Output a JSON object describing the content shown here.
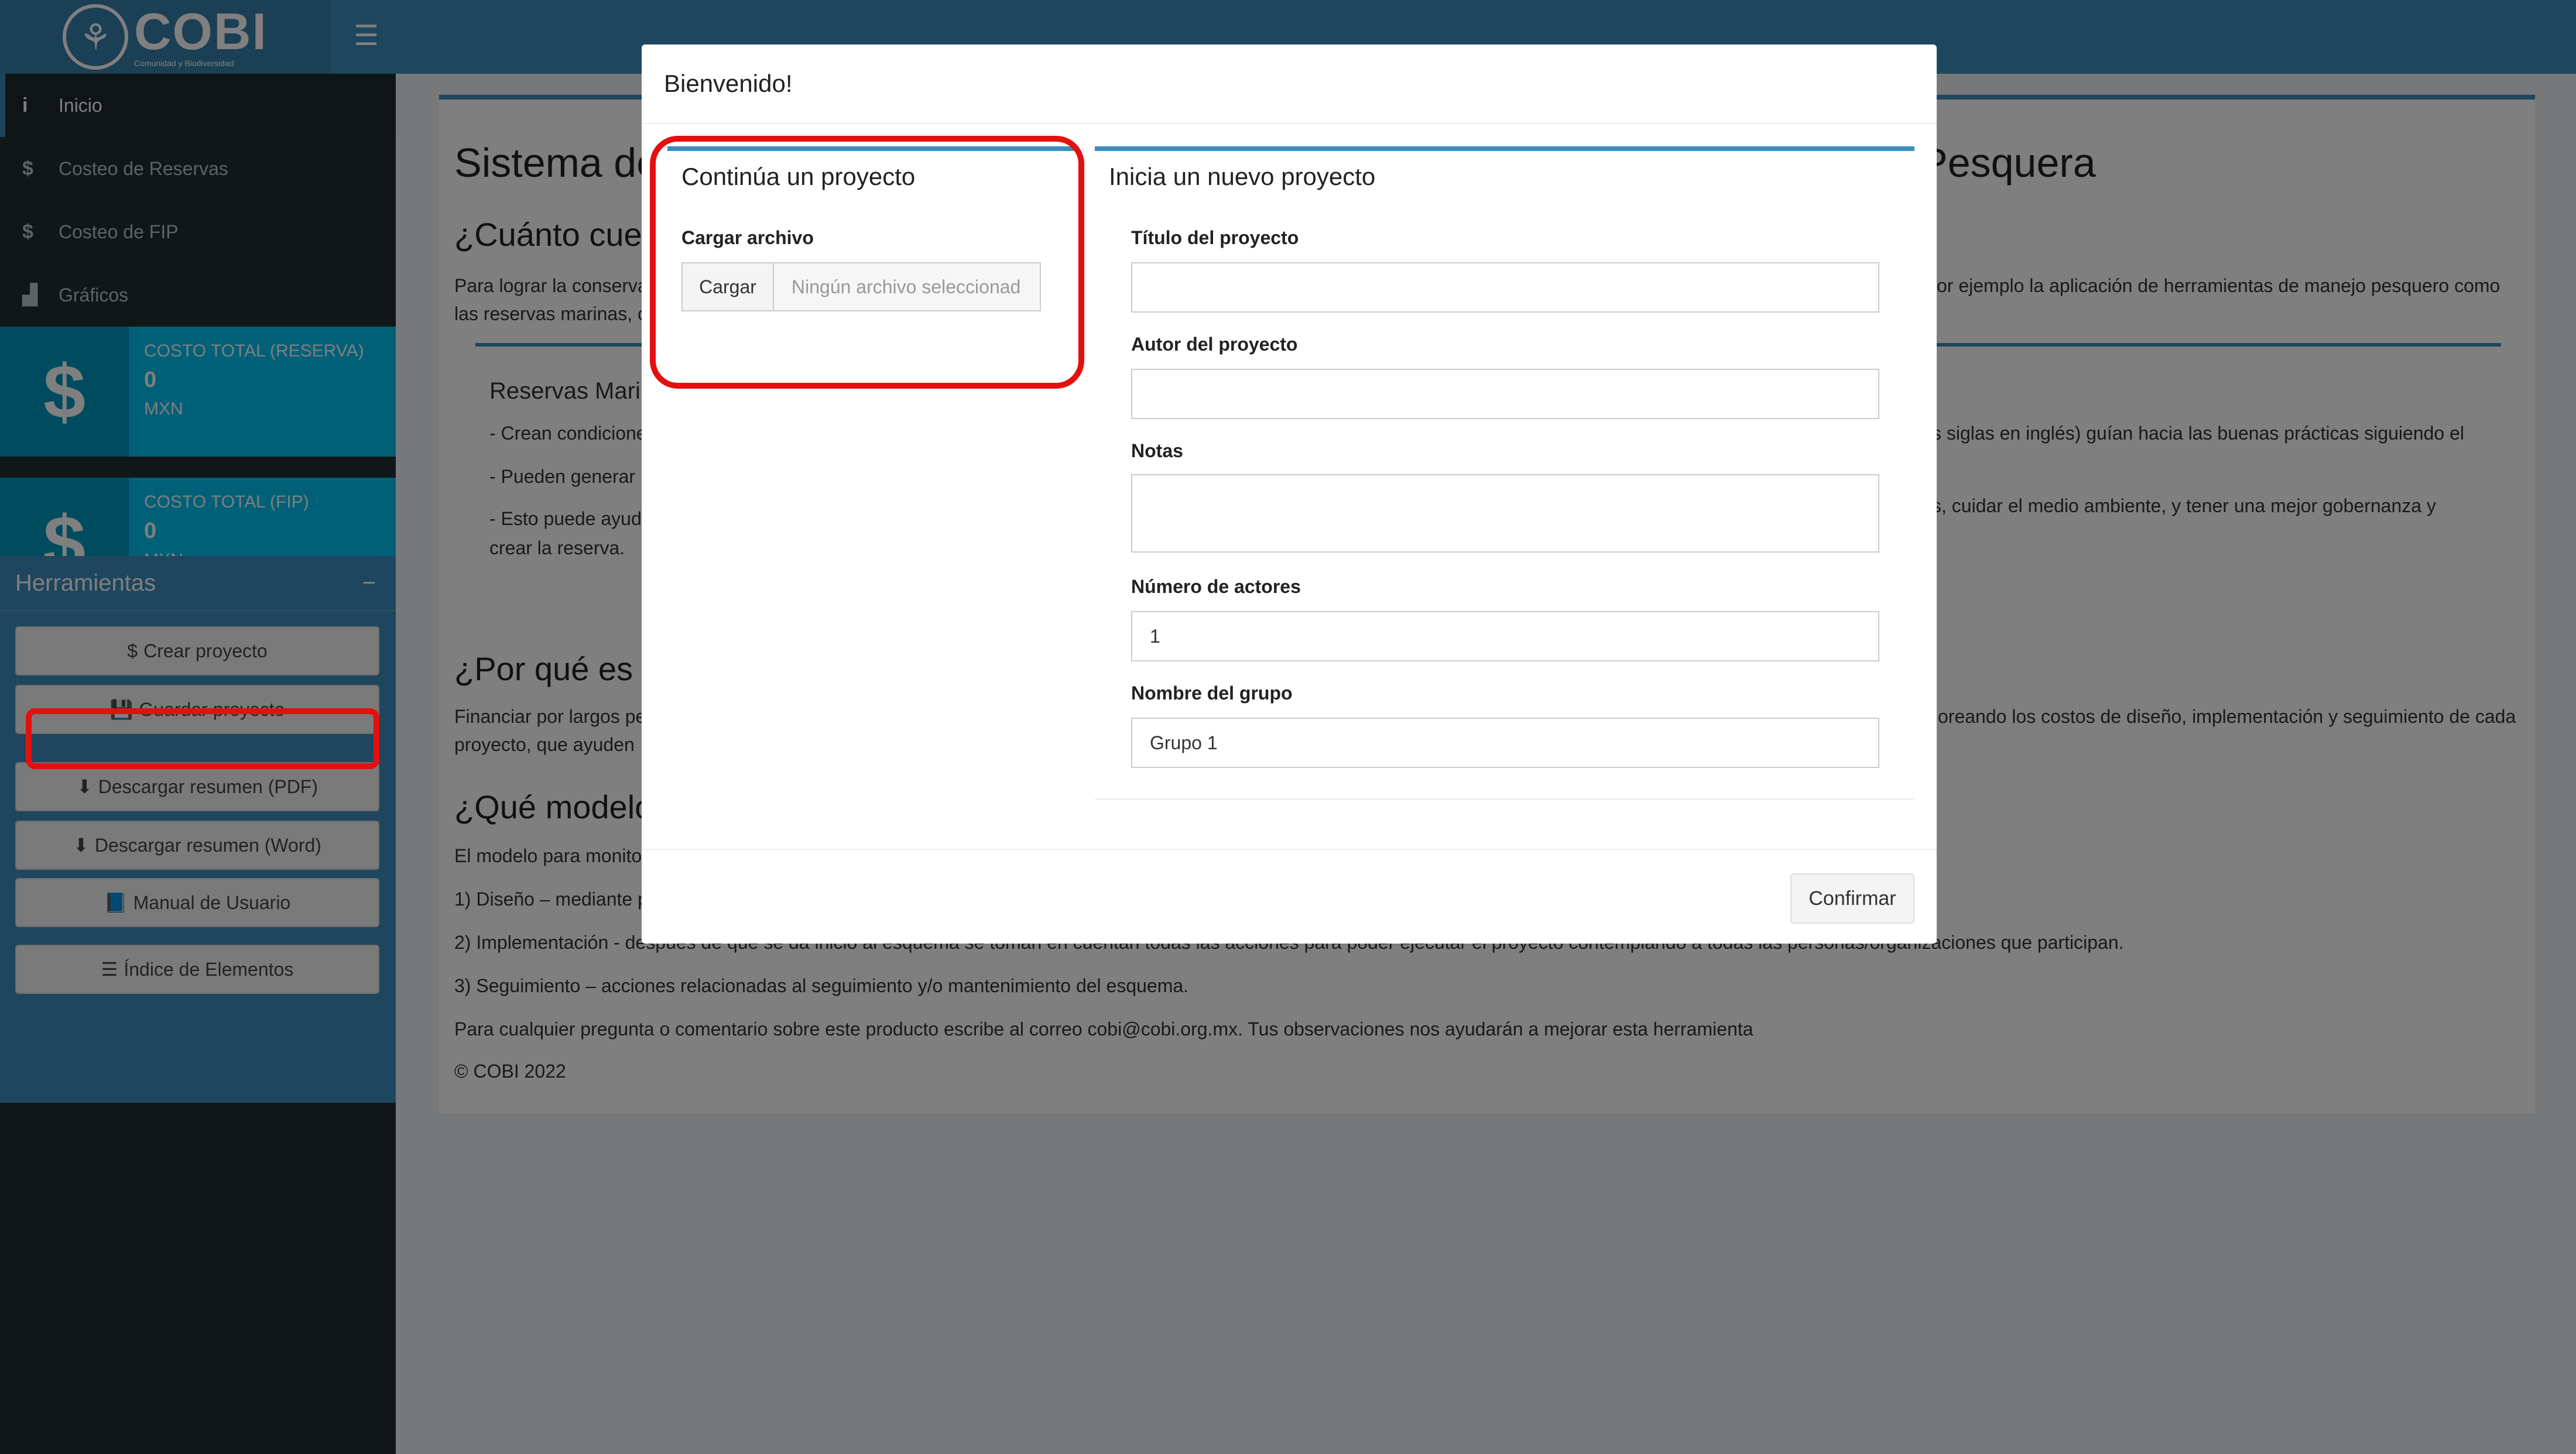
{
  "header": {
    "logo_text": "COBI",
    "logo_sub": "Comunidad y Biodiversidad",
    "menu_icon": "☰"
  },
  "sidebar": {
    "items": [
      {
        "icon": "i",
        "label": "Inicio"
      },
      {
        "icon": "$",
        "label": "Costeo de Reservas"
      },
      {
        "icon": "$",
        "label": "Costeo de FIP"
      },
      {
        "icon": "▟",
        "label": "Gráficos"
      }
    ],
    "box1": {
      "title": "COSTO TOTAL (RESERVA)",
      "value": "0",
      "unit": "MXN"
    },
    "box2": {
      "title": "COSTO TOTAL (FIP)",
      "value": "0",
      "unit": "MXN"
    },
    "tools": {
      "title": "Herramientas",
      "collapse": "−",
      "buttons": [
        {
          "icon": "$",
          "label": "Crear proyecto"
        },
        {
          "icon": "💾",
          "label": "Guardar proyecto"
        },
        {
          "icon": "⬇",
          "label": "Descargar resumen (PDF)"
        },
        {
          "icon": "⬇",
          "label": "Descargar resumen (Word)"
        },
        {
          "icon": "📘",
          "label": "Manual de Usuario"
        },
        {
          "icon": "☰",
          "label": "Índice de Elementos"
        }
      ]
    }
  },
  "main": {
    "title_left": "Sistema de",
    "title_right": "Pesquera",
    "q1": "¿Cuánto cues",
    "p1a": "Para lograr la conserva",
    "p1b": "las reservas marinas, c",
    "p1r": "or ejemplo la aplicación de herramientas de manejo pesquero como",
    "sub1": "Reservas Mari",
    "b1": "- Crean condicione",
    "b1r": "s siglas en inglés) guían hacia las buenas prácticas siguiendo el",
    "b2": "- Pueden generar",
    "b3": "- Esto puede ayud",
    "b3r": "s, cuidar el medio ambiente, y tener una mejor gobernanza y",
    "b3b": "crear la reserva.",
    "q2": "¿Por qué es ú",
    "p2a": "Financiar por largos pe",
    "p2b": "proyecto, que ayuden",
    "p2r": "oreando los costos de diseño, implementación y seguimiento de cada",
    "q3": "¿Qué modelo",
    "p3": "El modelo para monito",
    "l1": "1) Diseño – mediante p",
    "l2": "2) Implementación - después de que se da inicio al esquema se toman en cuentan todas las acciones para poder ejecutar el proyecto contemplando a todas las personas/organizaciones que participan.",
    "l3": "3) Seguimiento – acciones relacionadas al seguimiento y/o mantenimiento del esquema.",
    "contact": "Para cualquier pregunta o comentario sobre este producto escribe al correo cobi@cobi.org.mx. Tus observaciones nos ayudarán a mejorar esta herramienta",
    "copyright": "© COBI 2022"
  },
  "modal": {
    "title": "Bienvenido!",
    "left": {
      "title": "Continúa un proyecto",
      "file_label": "Cargar archivo",
      "file_button": "Cargar",
      "file_placeholder": "Ningún archivo seleccionad"
    },
    "right": {
      "title": "Inicia un nuevo proyecto",
      "fields": [
        {
          "label": "Título del proyecto",
          "value": ""
        },
        {
          "label": "Autor del proyecto",
          "value": ""
        },
        {
          "label": "Notas",
          "value": ""
        },
        {
          "label": "Número de actores",
          "value": "1"
        },
        {
          "label": "Nombre del grupo",
          "value": "Grupo 1"
        }
      ]
    },
    "confirm": "Confirmar"
  },
  "colors": {
    "accent": "#3c8dbc",
    "highlight": "#e41010",
    "sidebar": "#222d32"
  }
}
